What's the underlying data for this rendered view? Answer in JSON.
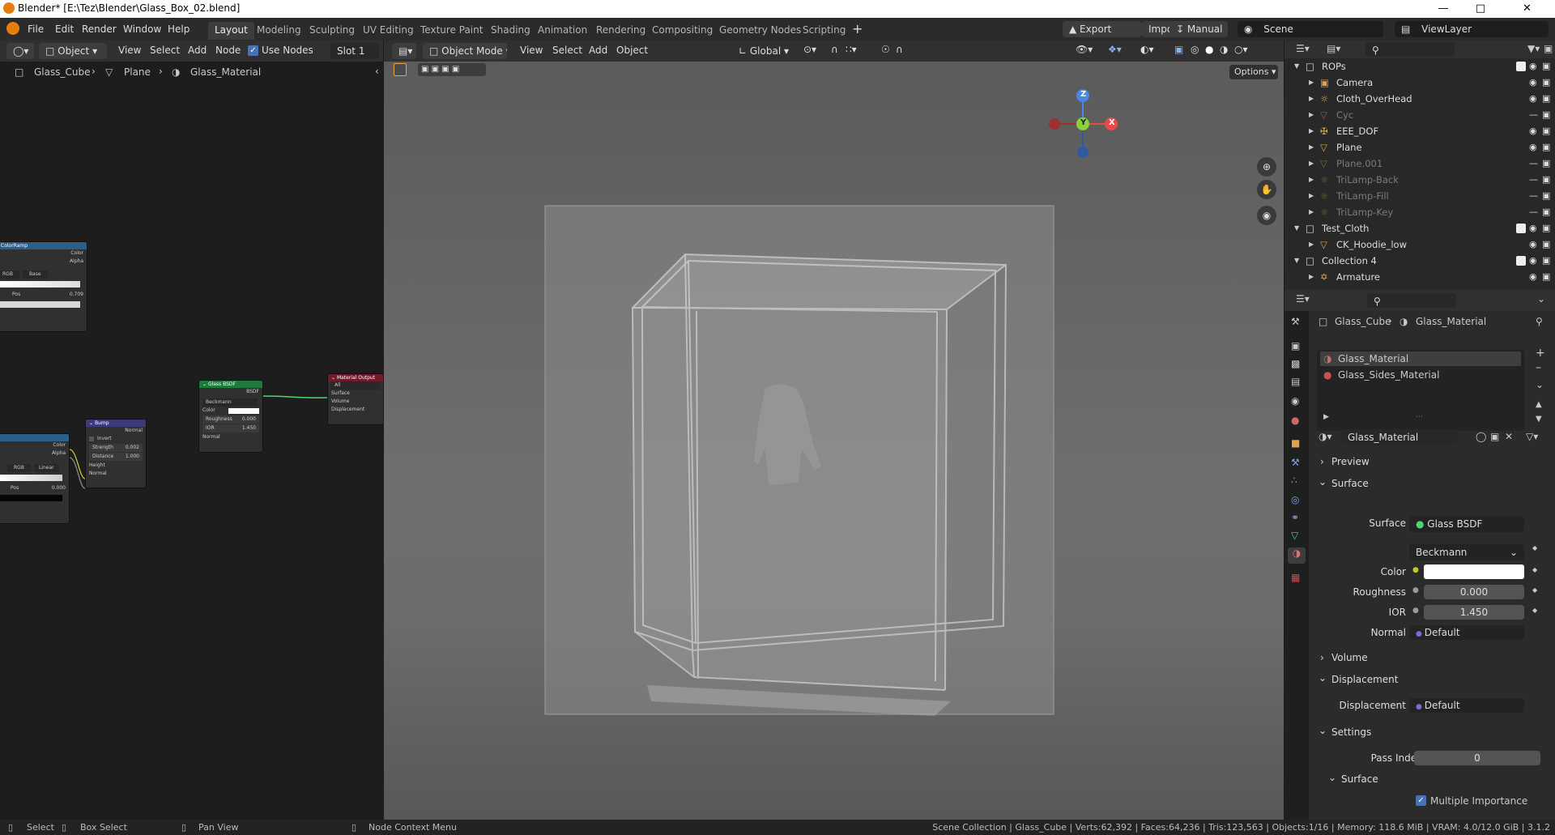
{
  "window": {
    "title": "Blender* [E:\\Tez\\Blender\\Glass_Box_02.blend]"
  },
  "menu": [
    "File",
    "Edit",
    "Render",
    "Window",
    "Help"
  ],
  "workspaces": [
    "Layout",
    "Modeling",
    "Sculpting",
    "UV Editing",
    "Texture Paint",
    "Shading",
    "Animation",
    "Rendering",
    "Compositing",
    "Geometry Nodes",
    "Scripting"
  ],
  "active_workspace": "Layout",
  "topright": {
    "export": "Export",
    "import": "Import",
    "manual": "Manual",
    "scene": "Scene",
    "viewlayer": "ViewLayer"
  },
  "node_editor": {
    "mode": "Object",
    "menus": [
      "View",
      "Select",
      "Add",
      "Node"
    ],
    "use_nodes": "Use Nodes",
    "slot": "Slot 1",
    "breadcrumb": [
      "Glass_Cube",
      "Plane",
      "Glass_Material"
    ],
    "nodes": {
      "colorramp": {
        "title": "ColorRamp",
        "out1": "Color",
        "out2": "Alpha",
        "mode": "RGB",
        "interp": "Base",
        "pos_label": "Pos",
        "pos": "0.709"
      },
      "glass": {
        "title": "Glass BSDF",
        "out": "BSDF",
        "dist": "Beckmann",
        "color": "Color",
        "roughness": "Roughness",
        "rough_val": "0.000",
        "ior": "IOR",
        "ior_val": "1.450",
        "normal": "Normal"
      },
      "output": {
        "title": "Material Output",
        "target": "All",
        "surface": "Surface",
        "volume": "Volume",
        "displacement": "Displacement"
      },
      "bump": {
        "title": "Bump",
        "out": "Normal",
        "invert": "Invert",
        "strength": "Strength",
        "strength_val": "0.002",
        "distance": "Distance",
        "distance_val": "1.000",
        "height": "Height",
        "normal": "Normal"
      },
      "ramp2": {
        "out1": "Color",
        "out2": "Alpha",
        "mode": "RGB",
        "interp": "Linear",
        "pos_label": "Pos",
        "pos": "0.000"
      }
    }
  },
  "viewport": {
    "mode": "Object Mode",
    "menus": [
      "View",
      "Select",
      "Add",
      "Object"
    ],
    "orientation": "Global",
    "options": "Options",
    "gizmo": {
      "x": "X",
      "y": "Y",
      "z": "Z"
    }
  },
  "outliner": {
    "rows": [
      {
        "label": "ROPs",
        "kind": "collection",
        "indent": 0,
        "expanded": true
      },
      {
        "label": "Camera",
        "kind": "camera",
        "indent": 1
      },
      {
        "label": "Cloth_OverHead",
        "kind": "light",
        "indent": 1
      },
      {
        "label": "Cyc",
        "kind": "mesh",
        "indent": 1,
        "dim": true
      },
      {
        "label": "EEE_DOF",
        "kind": "empty",
        "indent": 1
      },
      {
        "label": "Plane",
        "kind": "mesh",
        "indent": 1
      },
      {
        "label": "Plane.001",
        "kind": "mesh",
        "indent": 1,
        "dim": true
      },
      {
        "label": "TriLamp-Back",
        "kind": "light",
        "indent": 1,
        "dim": true
      },
      {
        "label": "TriLamp-Fill",
        "kind": "light",
        "indent": 1,
        "dim": true
      },
      {
        "label": "TriLamp-Key",
        "kind": "light",
        "indent": 1,
        "dim": true
      },
      {
        "label": "Test_Cloth",
        "kind": "collection",
        "indent": 0,
        "expanded": true
      },
      {
        "label": "CK_Hoodie_low",
        "kind": "mesh",
        "indent": 1
      },
      {
        "label": "Collection 4",
        "kind": "collection",
        "indent": 0,
        "expanded": true
      },
      {
        "label": "Armature",
        "kind": "armature",
        "indent": 1
      }
    ]
  },
  "properties": {
    "breadcrumb": [
      "Glass_Cube",
      "Glass_Material"
    ],
    "slots": [
      "Glass_Material",
      "Glass_Sides_Material"
    ],
    "material_name": "Glass_Material",
    "panels": {
      "preview": "Preview",
      "surface": "Surface",
      "volume": "Volume",
      "displacement": "Displacement",
      "settings": "Settings",
      "surface_sub": "Surface"
    },
    "surface": {
      "label": "Surface",
      "value": "Glass BSDF",
      "distribution": "Beckmann",
      "color_label": "Color",
      "color": "#ffffff",
      "roughness_label": "Roughness",
      "roughness": "0.000",
      "ior_label": "IOR",
      "ior": "1.450",
      "normal_label": "Normal",
      "normal": "Default"
    },
    "displacement": {
      "label": "Displacement",
      "value": "Default"
    },
    "settings": {
      "pass_index_label": "Pass Index",
      "pass_index": "0",
      "multiple_importance": "Multiple Importance"
    }
  },
  "statusbar": {
    "select": "Select",
    "box_select": "Box Select",
    "pan_view": "Pan View",
    "context_menu": "Node Context Menu",
    "stats": "Scene Collection | Glass_Cube | Verts:62,392 | Faces:64,236 | Tris:123,563 | Objects:1/16 | Memory: 118.6 MiB | VRAM: 4.0/12.0 GiB | 3.1.2"
  },
  "colors": {
    "accent": "#4772b3",
    "orange": "#e87d0d",
    "node_green": "#1f7a3a",
    "node_red": "#6e1c2a",
    "node_blue": "#2a5f8a",
    "node_purple": "#3b3b7a"
  }
}
